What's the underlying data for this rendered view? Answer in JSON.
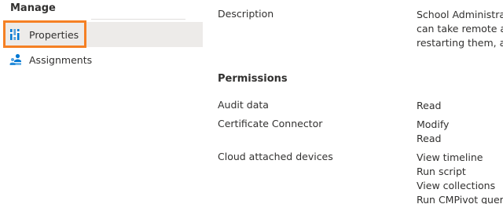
{
  "nav": {
    "header": "Manage",
    "items": [
      {
        "label": "Properties",
        "icon": "properties-icon",
        "selected": true
      },
      {
        "label": "Assignments",
        "icon": "assignments-icon",
        "selected": false
      }
    ]
  },
  "details": {
    "description_key": "Description",
    "description_lines": [
      "School Administrato",
      "can take remote ac",
      "restarting them, and"
    ]
  },
  "permissions": {
    "title": "Permissions",
    "rows": [
      {
        "key": "Audit data",
        "values": [
          "Read"
        ]
      },
      {
        "key": "Certificate Connector",
        "values": [
          "Modify",
          "Read"
        ]
      },
      {
        "key": "Cloud attached devices",
        "values": [
          "View timeline",
          "Run script",
          "View collections",
          "Run CMPivot query"
        ]
      }
    ]
  },
  "colors": {
    "highlight": "#f58024",
    "selected_bg": "#edebe9",
    "icon_blue": "#0078d4"
  }
}
